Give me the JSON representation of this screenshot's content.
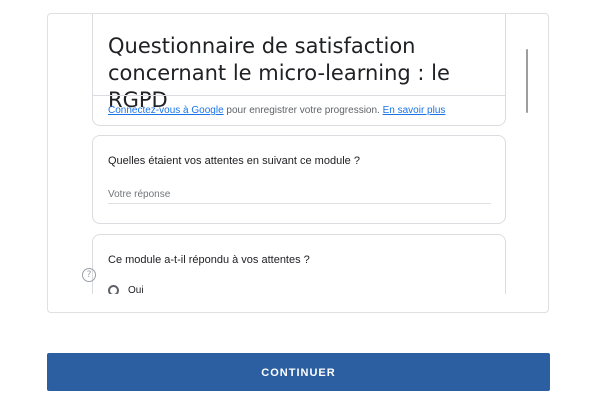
{
  "form": {
    "title": "Questionnaire de satisfaction concernant le micro-learning : le RGPD",
    "signin": {
      "link_text": "Connectez-vous à Google",
      "middle_text": " pour enregistrer votre progression. ",
      "learn_more": "En savoir plus"
    },
    "questions": [
      {
        "text": "Quelles étaient vos attentes en suivant ce module ?",
        "placeholder": "Votre réponse"
      },
      {
        "text": "Ce module a-t-il répondu à vos attentes ?",
        "options": [
          "Oui"
        ]
      }
    ]
  },
  "help_icon": {
    "name": "help-icon",
    "glyph": "?"
  },
  "continue_button": {
    "label": "CONTINUER"
  },
  "colors": {
    "button": "#2c5fa1",
    "link": "#1a73e8",
    "text": "#202124",
    "border": "#dadce0"
  }
}
